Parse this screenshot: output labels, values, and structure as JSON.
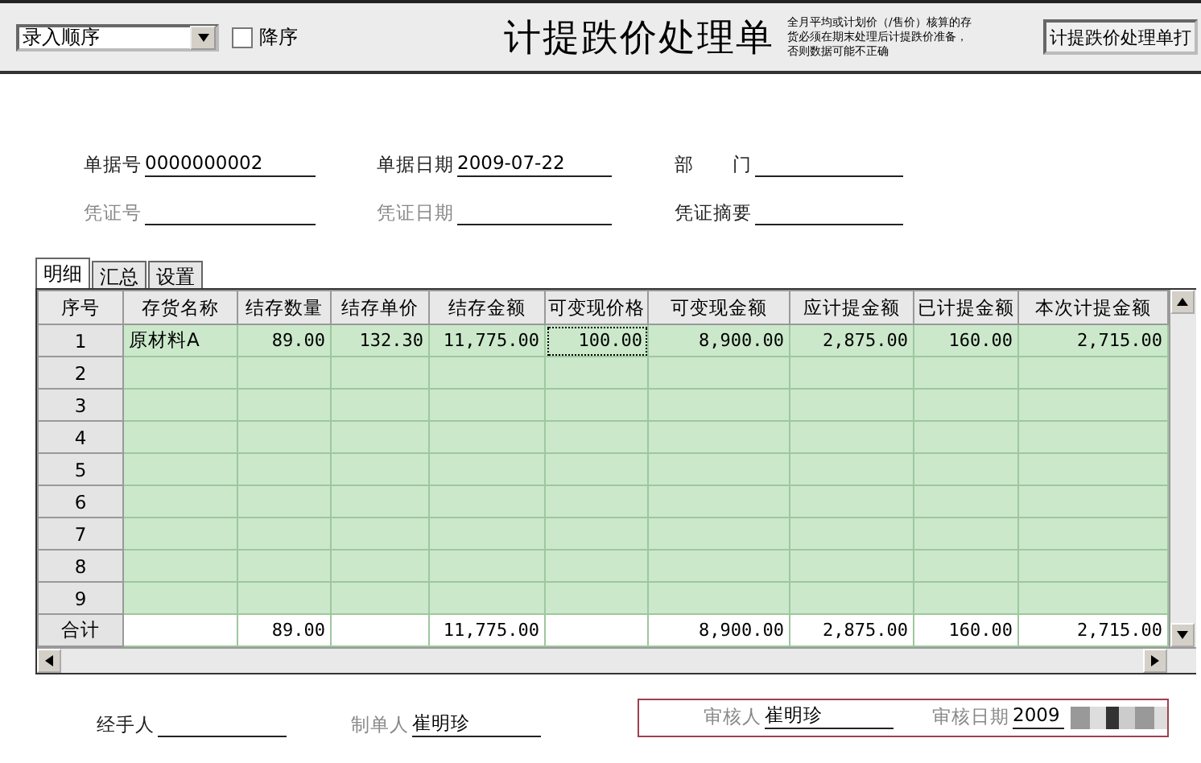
{
  "toolbar": {
    "sort_dropdown": {
      "value": "录入顺序"
    },
    "descending": {
      "label": "降序",
      "checked": false
    },
    "title": "计提跌价处理单",
    "note": "全月平均或计划价（/售价）核算的存货必须在期末处理后计提跌价准备，否则数据可能不正确",
    "print_button": "计提跌价处理单打"
  },
  "header_fields": [
    {
      "label": "单据号",
      "value": "0000000002",
      "disabled": false
    },
    {
      "label": "单据日期",
      "value": "2009-07-22",
      "disabled": false
    },
    {
      "label": "部　　门",
      "disabled": false
    },
    {
      "label": "凭证号",
      "disabled": true
    },
    {
      "label": "凭证日期",
      "disabled": true
    },
    {
      "label": "凭证摘要",
      "disabled": false
    }
  ],
  "tabs": [
    {
      "label": "明细",
      "selected": true
    },
    {
      "label": "汇总",
      "selected": false
    },
    {
      "label": "设置",
      "selected": false
    }
  ],
  "table": {
    "columns": [
      "序号",
      "存货名称",
      "结存数量",
      "结存单价",
      "结存金额",
      "可变现价格",
      "可变现金额",
      "应计提金额",
      "已计提金额",
      "本次计提金额"
    ],
    "rows": [
      {
        "cells": [
          "1",
          "原材料A",
          "89.00",
          "132.30",
          "11,775.00",
          {
            "text": "100.00",
            "focused": true
          },
          "8,900.00",
          "2,875.00",
          "160.00",
          "2,715.00"
        ]
      },
      {
        "cells": [
          "2"
        ]
      },
      {
        "cells": [
          "3"
        ]
      },
      {
        "cells": [
          "4"
        ]
      },
      {
        "cells": [
          "5"
        ]
      },
      {
        "cells": [
          "6"
        ]
      },
      {
        "cells": [
          "7"
        ]
      },
      {
        "cells": [
          "8"
        ]
      },
      {
        "cells": [
          "9"
        ]
      }
    ],
    "total_row": [
      {
        "kind": "label",
        "text": "合计"
      },
      {
        "kind": "blank"
      },
      {
        "kind": "value",
        "text": "89.00"
      },
      {
        "kind": "blank"
      },
      {
        "kind": "value",
        "text": "11,775.00"
      },
      {
        "kind": "blank"
      },
      {
        "kind": "value",
        "text": "8,900.00"
      },
      {
        "kind": "value",
        "text": "2,875.00"
      },
      {
        "kind": "value",
        "text": "160.00"
      },
      {
        "kind": "value",
        "text": "2,715.00"
      }
    ]
  },
  "footer_fields": [
    {
      "label": "经手人",
      "disabled": false
    },
    {
      "label": "制单人",
      "value": "崔明珍",
      "disabled": true
    }
  ],
  "approval_fields": [
    {
      "label": "审核人",
      "value": "崔明珍",
      "disabled": true
    },
    {
      "label": "审核日期",
      "value": "2009",
      "disabled": true,
      "redacted": true
    }
  ]
}
